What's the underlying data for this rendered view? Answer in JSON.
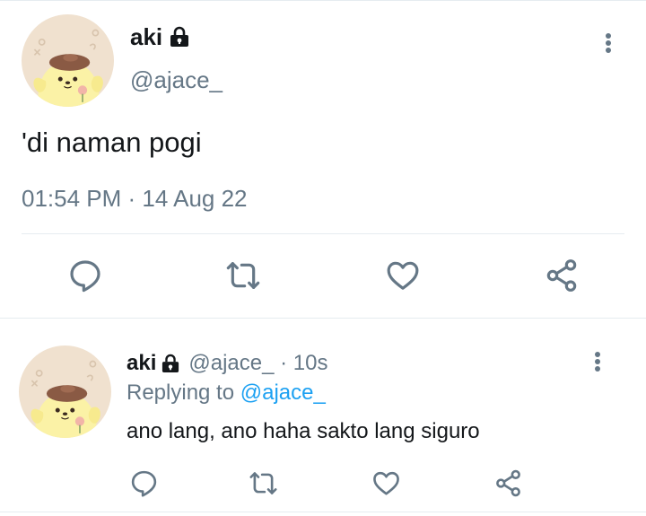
{
  "main_tweet": {
    "author": {
      "display_name": "aki",
      "handle": "@ajace_",
      "protected_icon": "lock-icon",
      "avatar_icon": "pompompurin-avatar"
    },
    "text": "'di naman pogi",
    "timestamp": "01:54 PM · 14 Aug 22",
    "more_icon": "more-vertical-icon",
    "actions": [
      "reply-icon",
      "retweet-icon",
      "like-icon",
      "share-icon"
    ]
  },
  "reply_tweet": {
    "author": {
      "display_name": "aki",
      "handle_time": "@ajace_ · 10s",
      "protected_icon": "lock-icon",
      "avatar_icon": "pompompurin-avatar"
    },
    "replying_label": "Replying to",
    "replying_to": "@ajace_",
    "text": "ano lang, ano haha sakto lang siguro",
    "more_icon": "more-vertical-icon",
    "actions": [
      "reply-icon",
      "retweet-icon",
      "like-icon",
      "share-icon"
    ]
  },
  "colors": {
    "text": "#14171a",
    "secondary": "#657786",
    "mention": "#1da1f2",
    "divider": "#e6ecf0",
    "avatar_background": "#f0e1cf",
    "avatar_character": "#fbf2a6",
    "avatar_hat": "#8a5a44"
  }
}
